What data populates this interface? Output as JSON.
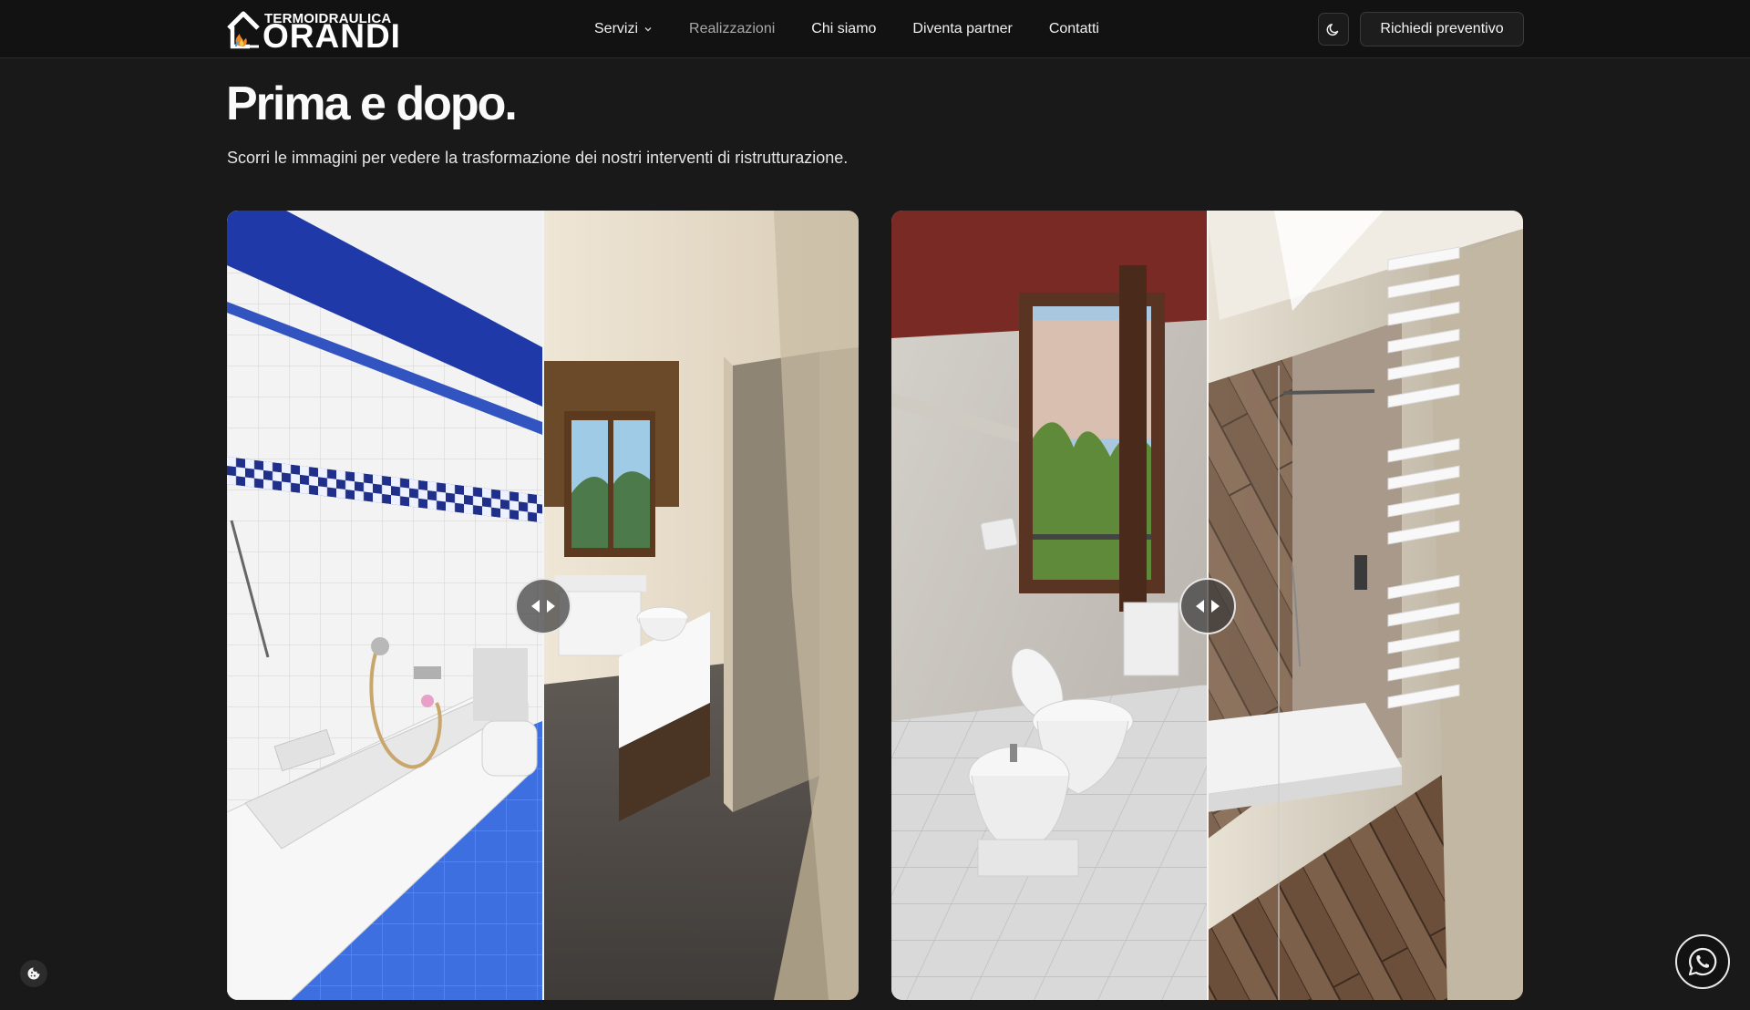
{
  "header": {
    "logo": {
      "top": "TERMOIDRAULICA",
      "main": "ORANDI"
    },
    "nav": [
      {
        "label": "Servizi",
        "has_dropdown": true,
        "active": false
      },
      {
        "label": "Realizzazioni",
        "has_dropdown": false,
        "active": true
      },
      {
        "label": "Chi siamo",
        "has_dropdown": false,
        "active": false
      },
      {
        "label": "Diventa partner",
        "has_dropdown": false,
        "active": false
      },
      {
        "label": "Contatti",
        "has_dropdown": false,
        "active": false
      }
    ],
    "theme_toggle_icon": "moon-icon",
    "cta_label": "Richiedi preventivo"
  },
  "main": {
    "title": "Prima e dopo.",
    "subtitle": "Scorri le immagini per vedere la trasformazione dei nostri interventi di ristrutturazione."
  },
  "comparisons": [
    {
      "slider_position": 0.5,
      "before": "bathroom-with-bathtub-and-blue-tiles",
      "after": "renovated-bathroom-with-window-and-vanity"
    },
    {
      "slider_position": 0.5,
      "before": "bathroom-with-toilet-bidet-and-marble-tiles",
      "after": "renovated-bathroom-with-walk-in-shower"
    }
  ],
  "floating": {
    "cookie_icon": "cookie-icon",
    "whatsapp_icon": "whatsapp-icon"
  },
  "colors": {
    "background": "#191919",
    "header": "#121212",
    "text": "#f2f2f2"
  }
}
